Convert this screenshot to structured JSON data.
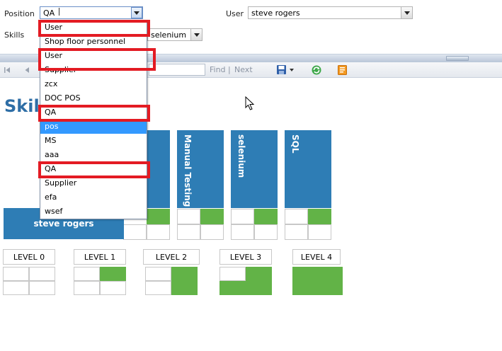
{
  "filters": {
    "position_label": "Position",
    "position_value": "QA",
    "user_label": "User",
    "user_value": "steve rogers",
    "skills_label": "Skills",
    "skills_value": "selenium"
  },
  "toolbar": {
    "find_label": "Find",
    "separator": "|",
    "next_label": "Next"
  },
  "report": {
    "title": "Skill"
  },
  "dropdown": {
    "items": [
      "User",
      "Shop floor personnel",
      "User",
      "Supplier",
      "zcx",
      "DOC POS",
      "QA",
      "pos",
      "MS",
      "aaa",
      "QA",
      "Supplier",
      "efa",
      "wsef"
    ],
    "selected": "pos",
    "highlighted_items": [
      "User",
      "User",
      "QA",
      "QA"
    ],
    "highlight_color": "#e31b23",
    "selection_color": "#3399ff"
  },
  "matrix": {
    "skills": [
      "Manual Testing",
      "selenium",
      "SQL"
    ],
    "user": "steve rogers",
    "header_color": "#2e7db5",
    "level_color": "#62b347"
  },
  "legend": {
    "levels": [
      {
        "label": "LEVEL 0",
        "filled": 0
      },
      {
        "label": "LEVEL 1",
        "filled": 1
      },
      {
        "label": "LEVEL 2",
        "filled": 2
      },
      {
        "label": "LEVEL 3",
        "filled": 3
      },
      {
        "label": "LEVEL 4",
        "filled": 4
      }
    ]
  },
  "icons": [
    "first-page-icon",
    "prev-page-icon",
    "save-export-icon",
    "dropdown-arrow-icon",
    "refresh-icon",
    "print-report-icon",
    "mouse-pointer-icon"
  ]
}
